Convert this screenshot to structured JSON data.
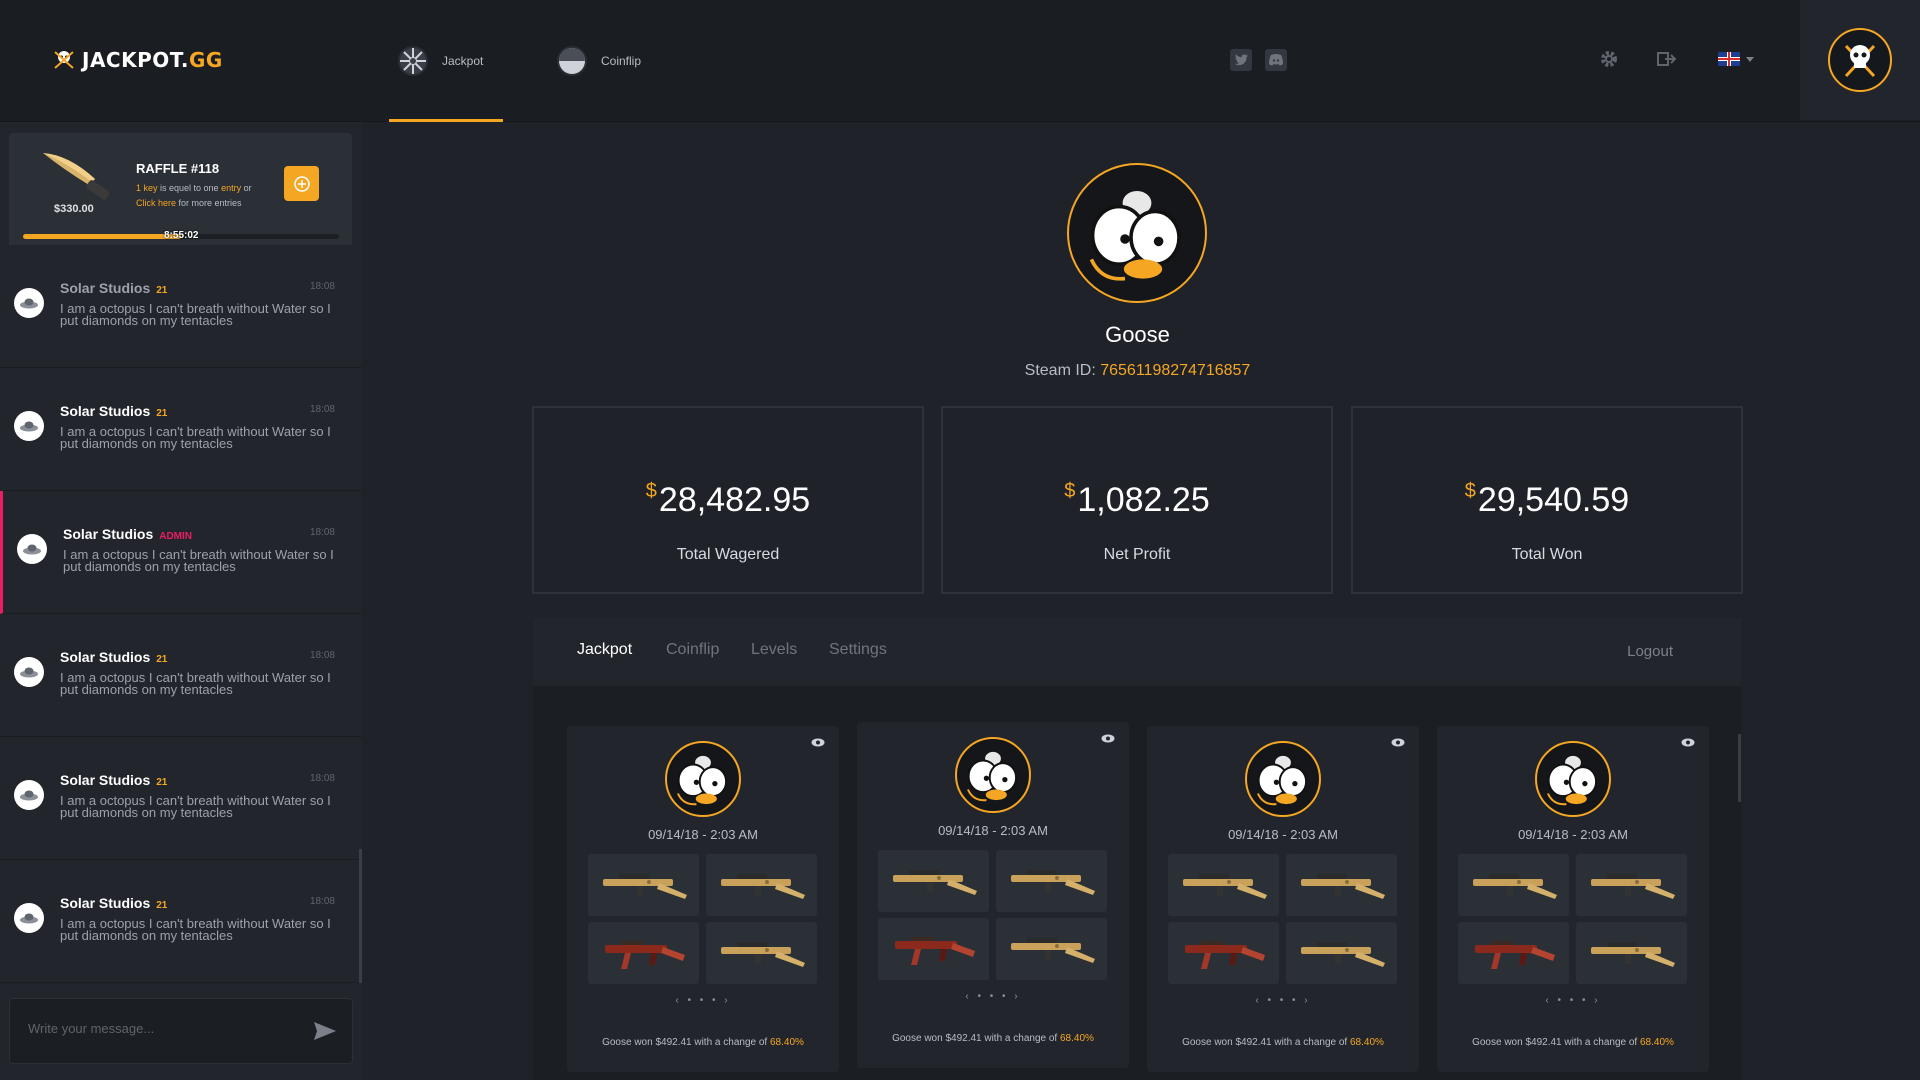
{
  "brand": {
    "name_main": "JACKPOT.",
    "name_accent": "GG"
  },
  "nav": [
    {
      "label": "Jackpot",
      "icon": "roulette-wheel-icon",
      "active": true
    },
    {
      "label": "Coinflip",
      "icon": "coin-icon",
      "active": false
    }
  ],
  "colors": {
    "accent": "#f5a623",
    "admin": "#e91e63",
    "background": "#1f2228",
    "panel": "#22262c"
  },
  "raffle": {
    "title": "RAFFLE #118",
    "price": "$330.00",
    "line1_prefix": "1 key",
    "line1_middle": " is equel to one ",
    "line1_accent": "entry",
    "line1_suffix": " or",
    "line2_accent": "Click here",
    "line2_suffix": " for more entries",
    "timer": "8:55:02",
    "progress": 0.5
  },
  "chat": {
    "messages": [
      {
        "user": "Solar Studios",
        "badge": "21",
        "time": "18:08",
        "text": "I am a octopus I can't breath without Water so I put diamonds on my tentacles"
      },
      {
        "user": "Solar Studios",
        "badge": "21",
        "time": "18:08",
        "text": "I am a octopus I can't breath without Water so I put diamonds on my tentacles"
      },
      {
        "user": "Solar Studios",
        "badge": "ADMIN",
        "time": "18:08",
        "text": "I am a octopus I can't breath without Water so I put diamonds on my tentacles"
      },
      {
        "user": "Solar Studios",
        "badge": "21",
        "time": "18:08",
        "text": "I am a octopus I can't breath without Water so I put diamonds on my tentacles"
      },
      {
        "user": "Solar Studios",
        "badge": "21",
        "time": "18:08",
        "text": "I am a octopus I can't breath without Water so I put diamonds on my tentacles"
      },
      {
        "user": "Solar Studios",
        "badge": "21",
        "time": "18:08",
        "text": "I am a octopus I can't breath without Water so I put diamonds on my tentacles"
      }
    ],
    "input_placeholder": "Write your message..."
  },
  "profile": {
    "name": "Goose",
    "steam_label": "Steam ID: ",
    "steam_id": "76561198274716857"
  },
  "stats": [
    {
      "currency": "$",
      "value": "28,482.95",
      "label": "Total Wagered"
    },
    {
      "currency": "$",
      "value": "1,082.25",
      "label": "Net Profit"
    },
    {
      "currency": "$",
      "value": "29,540.59",
      "label": "Total Won"
    }
  ],
  "tabs": [
    {
      "label": "Jackpot",
      "active": true
    },
    {
      "label": "Coinflip",
      "active": false
    },
    {
      "label": "Levels",
      "active": false
    },
    {
      "label": "Settings",
      "active": false
    }
  ],
  "logout_label": "Logout",
  "history": [
    {
      "date": "09/14/18 - 2:03 AM",
      "pager": "‹ • • • ›",
      "won_prefix": "Goose won $492.41 with a change of ",
      "won_chance": "68.40%"
    },
    {
      "date": "09/14/18 - 2:03 AM",
      "pager": "‹ • • • ›",
      "won_prefix": "Goose won $492.41 with a change of ",
      "won_chance": "68.40%"
    },
    {
      "date": "09/14/18 - 2:03 AM",
      "pager": "‹ • • • ›",
      "won_prefix": "Goose won $492.41 with a change of ",
      "won_chance": "68.40%"
    },
    {
      "date": "09/14/18 - 2:03 AM",
      "pager": "‹ • • • ›",
      "won_prefix": "Goose won $492.41 with a change of ",
      "won_chance": "68.40%"
    }
  ]
}
